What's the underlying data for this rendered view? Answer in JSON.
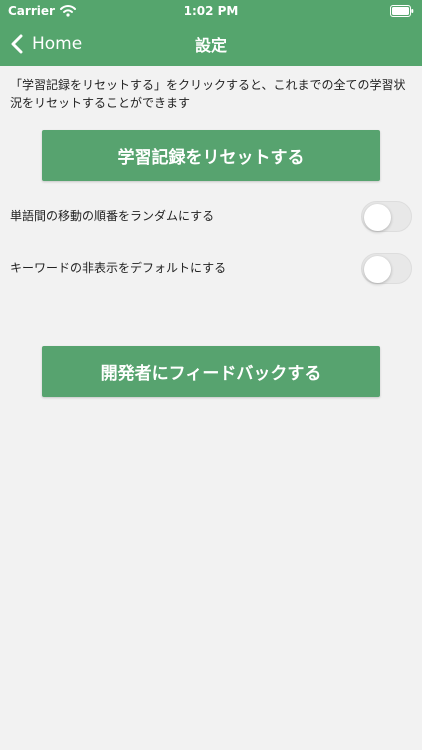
{
  "status_bar": {
    "carrier": "Carrier",
    "time": "1:02 PM",
    "wifi_icon": "wifi-icon",
    "battery_icon": "battery-icon"
  },
  "nav": {
    "back_label": "Home",
    "title": "設定",
    "back_icon": "chevron-left-icon"
  },
  "content": {
    "reset_description": "「学習記録をリセットする」をクリックすると、これまでの全ての学習状況をリセットすることができます",
    "reset_button_label": "学習記録をリセットする",
    "settings": [
      {
        "label": "単語間の移動の順番をランダムにする",
        "enabled": false
      },
      {
        "label": "キーワードの非表示をデフォルトにする",
        "enabled": false
      }
    ],
    "feedback_button_label": "開発者にフィードバックする"
  },
  "colors": {
    "accent": "#55a56d",
    "background": "#f2f2f2",
    "switch_off": "#e8e8e8"
  }
}
